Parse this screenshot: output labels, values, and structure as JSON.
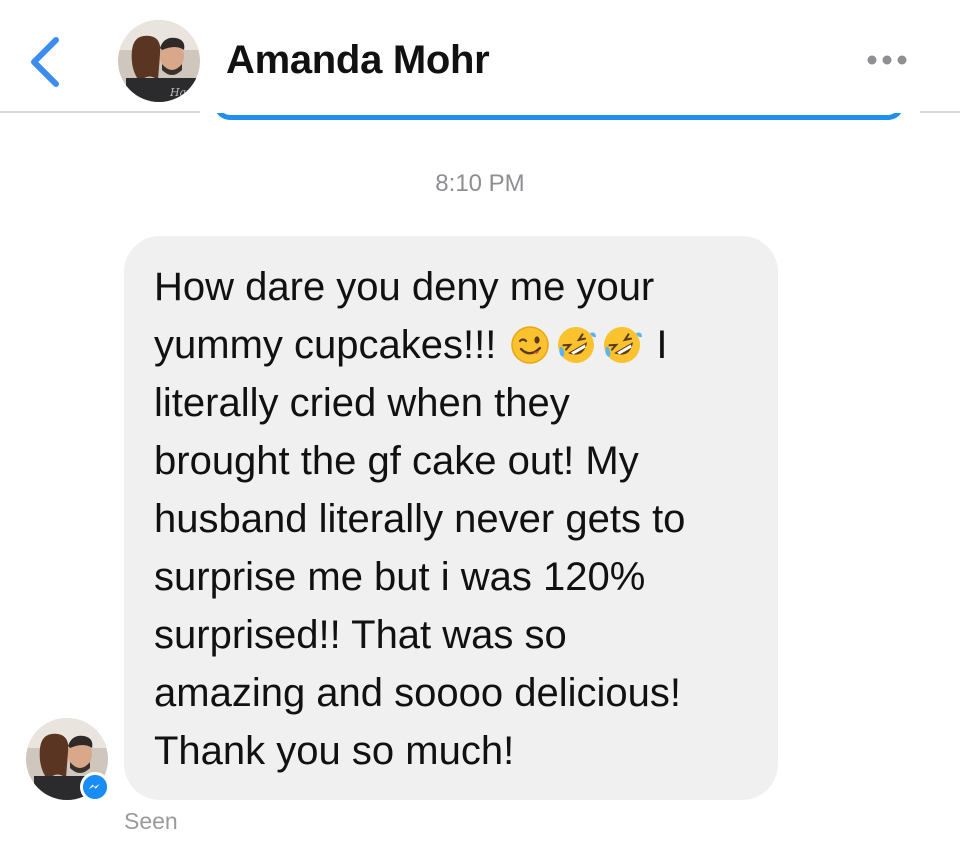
{
  "header": {
    "contact_name": "Amanda Mohr",
    "back_icon": "chevron-left-icon",
    "more_icon": "more-horizontal-icon",
    "accent_color": "#3b8ef0"
  },
  "conversation": {
    "timestamp": "8:10 PM",
    "message_lines": [
      "How dare you deny me your",
      "yummy cupcakes!!!",
      "literally cried when they",
      "brought the gf cake out! My",
      "husband literally never gets to",
      "surprise me but i was 120%",
      "surprised!! That was so",
      "amazing and soooo delicious!",
      "Thank you so much!"
    ],
    "line2_suffix": "I",
    "emojis": [
      "winking-face-emoji",
      "rolling-on-floor-laughing-emoji",
      "rolling-on-floor-laughing-emoji"
    ],
    "status": "Seen",
    "bubble_color": "#f0f0f0",
    "messenger_badge_color": "#1a8cf5"
  }
}
